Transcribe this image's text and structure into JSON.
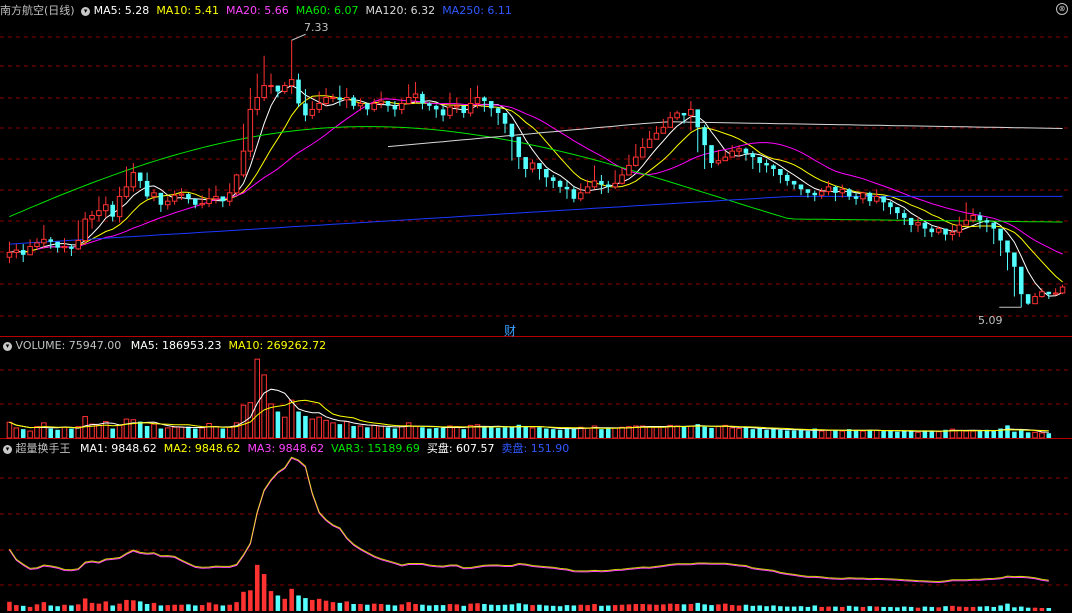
{
  "colors": {
    "up": "#ff3232",
    "down": "#54ffff",
    "ma5": "#ffffff",
    "ma10": "#ffff00",
    "ma20": "#ff00ff",
    "ma60": "#00e600",
    "ma120": "#d8d8d8",
    "ma250": "#1c38ff",
    "grid": "#8c0000",
    "hdr_text": "#c0c0c0"
  },
  "main_panel": {
    "title": "南方航空(日线)",
    "indicators": [
      {
        "label": "MA5: 5.28",
        "color": "#ffffff"
      },
      {
        "label": "MA10: 5.41",
        "color": "#ffff00"
      },
      {
        "label": "MA20: 5.66",
        "color": "#ff44ff"
      },
      {
        "label": "MA60: 6.07",
        "color": "#00e600"
      },
      {
        "label": "MA120: 6.32",
        "color": "#d8d8d8"
      },
      {
        "label": "MA250: 6.11",
        "color": "#2f58ff"
      }
    ],
    "high_label": "7.33",
    "low_label": "5.09",
    "fin_marker": "财",
    "close_icon": "⊗"
  },
  "volume_panel": {
    "title": "VOLUME: 75947.00",
    "indicators": [
      {
        "label": "MA5: 186953.23",
        "color": "#ffffff"
      },
      {
        "label": "MA10: 269262.72",
        "color": "#ffff00"
      }
    ]
  },
  "turnover_panel": {
    "title": "超量换手王",
    "indicators": [
      {
        "label": "MA1: 9848.62",
        "color": "#ffffff"
      },
      {
        "label": "MA2: 9848.62",
        "color": "#ffff00"
      },
      {
        "label": "MA3: 9848.62",
        "color": "#ff44ff"
      },
      {
        "label": "VAR3: 15189.69",
        "color": "#00e600"
      },
      {
        "label": "买盘: 607.57",
        "color": "#ffffff"
      },
      {
        "label": "卖盘: 151.90",
        "color": "#2f58ff"
      }
    ]
  },
  "chart_data": [
    {
      "type": "candlestick",
      "title": "南方航空(日线)",
      "ylim": [
        5.0,
        7.5
      ],
      "closes": [
        5.55,
        5.57,
        5.53,
        5.6,
        5.63,
        5.66,
        5.64,
        5.59,
        5.6,
        5.58,
        5.65,
        5.83,
        5.86,
        5.9,
        5.95,
        5.85,
        6.02,
        6.1,
        6.22,
        6.15,
        6.02,
        6.05,
        5.95,
        5.98,
        6.03,
        6.04,
        6.0,
        5.95,
        5.96,
        6.0,
        6.02,
        5.98,
        6.05,
        6.2,
        6.4,
        6.75,
        6.85,
        6.95,
        6.95,
        6.9,
        6.95,
        7.0,
        6.8,
        6.7,
        6.75,
        6.8,
        6.85,
        6.85,
        6.83,
        6.85,
        6.78,
        6.8,
        6.75,
        6.8,
        6.82,
        6.78,
        6.75,
        6.8,
        6.85,
        6.88,
        6.8,
        6.78,
        6.75,
        6.7,
        6.77,
        6.78,
        6.72,
        6.8,
        6.85,
        6.82,
        6.76,
        6.72,
        6.63,
        6.52,
        6.35,
        6.25,
        6.3,
        6.25,
        6.18,
        6.15,
        6.1,
        6.08,
        6.0,
        6.05,
        6.1,
        6.15,
        6.12,
        6.1,
        6.13,
        6.2,
        6.28,
        6.35,
        6.43,
        6.5,
        6.55,
        6.6,
        6.68,
        6.72,
        6.7,
        6.75,
        6.6,
        6.45,
        6.3,
        6.32,
        6.35,
        6.4,
        6.42,
        6.38,
        6.35,
        6.3,
        6.28,
        6.25,
        6.2,
        6.15,
        6.12,
        6.08,
        6.05,
        6.03,
        6.06,
        6.1,
        6.05,
        6.08,
        6.02,
        6.0,
        6.05,
        5.98,
        6.02,
        5.97,
        5.93,
        5.88,
        5.84,
        5.78,
        5.8,
        5.75,
        5.72,
        5.75,
        5.7,
        5.72,
        5.78,
        5.82,
        5.86,
        5.82,
        5.8,
        5.75,
        5.65,
        5.55,
        5.43,
        5.2,
        5.12,
        5.18,
        5.22,
        5.2,
        5.21,
        5.26
      ],
      "highs": [
        5.64,
        5.62,
        5.62,
        5.66,
        5.67,
        5.78,
        5.68,
        5.63,
        5.67,
        5.62,
        5.82,
        5.89,
        5.9,
        6.02,
        6.02,
        5.98,
        6.1,
        6.27,
        6.3,
        6.22,
        6.22,
        6.08,
        6.03,
        6.02,
        6.07,
        6.09,
        6.05,
        5.98,
        6.03,
        6.09,
        6.11,
        6.01,
        6.13,
        6.21,
        6.63,
        6.93,
        7.05,
        7.2,
        7.05,
        6.95,
        6.98,
        7.33,
        7.05,
        6.92,
        6.82,
        6.9,
        6.93,
        6.88,
        6.95,
        6.93,
        6.87,
        6.84,
        6.79,
        6.84,
        6.9,
        6.8,
        6.82,
        6.84,
        6.96,
        6.98,
        6.9,
        6.81,
        6.79,
        6.78,
        6.89,
        6.85,
        6.76,
        6.93,
        6.95,
        6.86,
        6.82,
        6.77,
        6.65,
        6.55,
        6.43,
        6.35,
        6.33,
        6.3,
        6.25,
        6.2,
        6.16,
        6.15,
        6.1,
        6.13,
        6.16,
        6.28,
        6.2,
        6.15,
        6.24,
        6.26,
        6.37,
        6.46,
        6.51,
        6.57,
        6.61,
        6.67,
        6.73,
        6.74,
        6.72,
        6.82,
        6.67,
        6.62,
        6.44,
        6.41,
        6.4,
        6.45,
        6.45,
        6.43,
        6.4,
        6.35,
        6.33,
        6.29,
        6.25,
        6.22,
        6.15,
        6.12,
        6.08,
        6.07,
        6.09,
        6.15,
        6.11,
        6.12,
        6.09,
        6.05,
        6.06,
        6.06,
        6.08,
        6.0,
        5.98,
        5.93,
        5.91,
        5.83,
        5.85,
        5.79,
        5.77,
        5.77,
        5.73,
        5.78,
        5.85,
        5.97,
        5.92,
        5.89,
        5.84,
        5.8,
        5.69,
        5.58,
        5.51,
        5.27,
        5.18,
        5.21,
        5.25,
        5.22,
        5.25,
        5.28
      ],
      "lows": [
        5.46,
        5.5,
        5.47,
        5.53,
        5.58,
        5.59,
        5.58,
        5.55,
        5.55,
        5.52,
        5.57,
        5.61,
        5.75,
        5.81,
        5.84,
        5.81,
        5.8,
        6.0,
        6.06,
        6.09,
        6.0,
        5.98,
        5.89,
        5.91,
        5.95,
        5.99,
        5.96,
        5.92,
        5.92,
        5.93,
        5.96,
        5.93,
        5.94,
        6.03,
        6.18,
        6.35,
        6.7,
        6.82,
        6.88,
        6.85,
        6.88,
        6.88,
        6.77,
        6.65,
        6.67,
        6.72,
        6.78,
        6.81,
        6.78,
        6.76,
        6.75,
        6.74,
        6.7,
        6.73,
        6.76,
        6.73,
        6.69,
        6.71,
        6.79,
        6.8,
        6.75,
        6.74,
        6.68,
        6.65,
        6.67,
        6.72,
        6.68,
        6.69,
        6.76,
        6.73,
        6.69,
        6.62,
        6.55,
        6.32,
        6.25,
        6.18,
        6.22,
        6.16,
        6.1,
        6.09,
        6.05,
        6.0,
        5.97,
        5.98,
        6.05,
        6.08,
        6.04,
        6.05,
        6.08,
        6.12,
        6.2,
        6.27,
        6.35,
        6.44,
        6.5,
        6.55,
        6.63,
        6.66,
        6.63,
        6.57,
        6.39,
        6.25,
        6.26,
        6.28,
        6.32,
        6.36,
        6.35,
        6.32,
        6.25,
        6.22,
        6.22,
        6.19,
        6.13,
        6.11,
        6.08,
        6.03,
        6.01,
        5.98,
        6.0,
        6.03,
        5.98,
        6.01,
        5.99,
        5.95,
        5.96,
        5.94,
        5.96,
        5.9,
        5.87,
        5.83,
        5.78,
        5.72,
        5.72,
        5.68,
        5.68,
        5.7,
        5.65,
        5.65,
        5.68,
        5.78,
        5.8,
        5.75,
        5.72,
        5.62,
        5.52,
        5.4,
        5.18,
        5.09,
        5.11,
        5.15,
        5.17,
        5.16,
        5.19,
        5.2
      ],
      "volume": [
        250000,
        160000,
        140000,
        110000,
        180000,
        240000,
        150000,
        130000,
        170000,
        150000,
        180000,
        340000,
        220000,
        200000,
        260000,
        150000,
        200000,
        300000,
        290000,
        260000,
        190000,
        220000,
        150000,
        160000,
        170000,
        170000,
        180000,
        150000,
        160000,
        230000,
        180000,
        150000,
        170000,
        240000,
        520000,
        560000,
        1250000,
        1000000,
        540000,
        420000,
        330000,
        600000,
        420000,
        350000,
        300000,
        330000,
        280000,
        240000,
        220000,
        260000,
        190000,
        190000,
        170000,
        200000,
        190000,
        170000,
        150000,
        180000,
        240000,
        190000,
        170000,
        150000,
        160000,
        160000,
        190000,
        180000,
        140000,
        200000,
        210000,
        190000,
        170000,
        160000,
        170000,
        180000,
        210000,
        180000,
        160000,
        170000,
        150000,
        140000,
        130000,
        160000,
        150000,
        170000,
        160000,
        190000,
        140000,
        150000,
        160000,
        170000,
        180000,
        190000,
        190000,
        180000,
        170000,
        180000,
        200000,
        190000,
        180000,
        190000,
        220000,
        180000,
        160000,
        180000,
        200000,
        160000,
        150000,
        170000,
        140000,
        150000,
        130000,
        150000,
        130000,
        120000,
        120000,
        130000,
        110000,
        150000,
        110000,
        120000,
        120000,
        110000,
        140000,
        120000,
        110000,
        130000,
        120000,
        110000,
        110000,
        100000,
        120000,
        110000,
        90000,
        120000,
        110000,
        100000,
        130000,
        140000,
        120000,
        110000,
        110000,
        120000,
        130000,
        110000,
        150000,
        200000,
        100000,
        120000,
        90000,
        90000,
        80000,
        75947
      ],
      "volume_ma5_last": 186953.23,
      "volume_ma10_last": 269262.72,
      "high_marker": 7.33,
      "low_marker": 5.09
    }
  ]
}
